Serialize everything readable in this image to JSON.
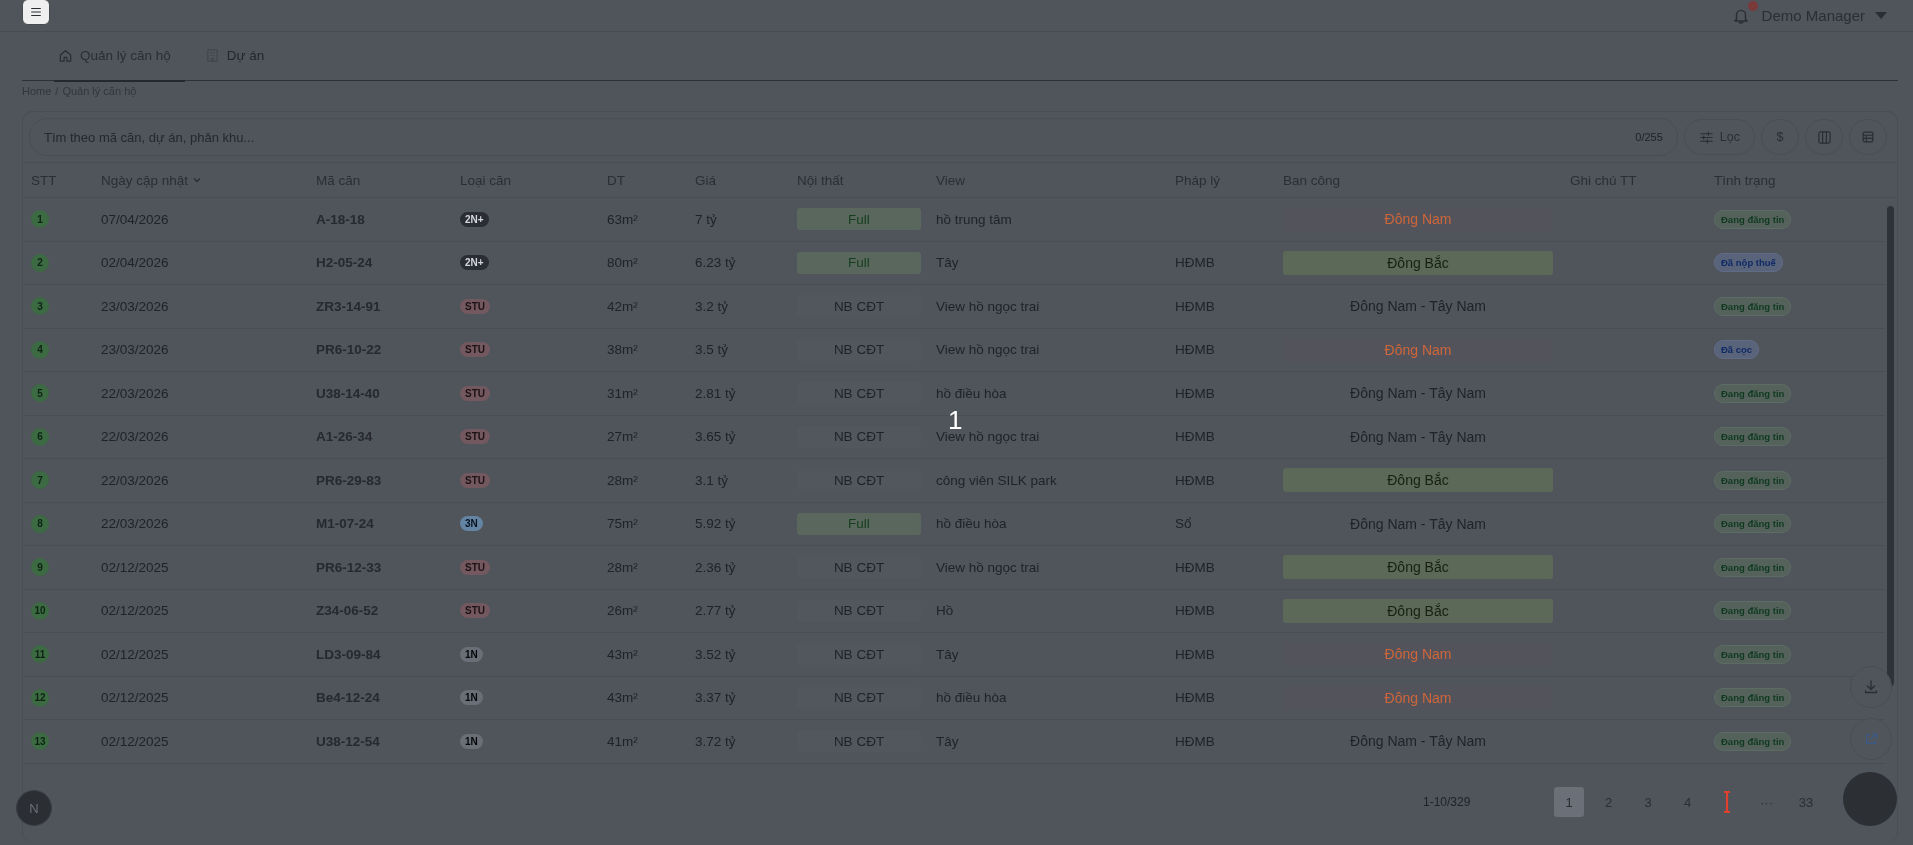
{
  "topbar": {
    "user": "Demo Manager"
  },
  "tabs": [
    {
      "label": "Quản lý căn hộ",
      "kind": "home",
      "selected": true
    },
    {
      "label": "Dự án",
      "kind": "building",
      "selected": false
    }
  ],
  "breadcrumb": {
    "items": [
      "Home",
      "Quản lý căn hộ"
    ],
    "separator": "/"
  },
  "search": {
    "placeholder": "Tìm theo mã căn, dự án, phân khu...",
    "counter": "0/255"
  },
  "toolbar": [
    {
      "kind": "filter",
      "label": "Lọc"
    },
    {
      "kind": "currency",
      "label": "$"
    },
    {
      "kind": "columns"
    },
    {
      "kind": "table"
    }
  ],
  "table": {
    "columns": [
      {
        "label": "STT",
        "sorted": false
      },
      {
        "label": "Ngày cập nhật",
        "sorted": true
      },
      {
        "label": "Mã căn",
        "sorted": false
      },
      {
        "label": "Loại căn",
        "sorted": false
      },
      {
        "label": "DT",
        "sorted": false
      },
      {
        "label": "Giá",
        "sorted": false
      },
      {
        "label": "Nội thất",
        "sorted": false
      },
      {
        "label": "View",
        "sorted": false
      },
      {
        "label": "Pháp lý",
        "sorted": false
      },
      {
        "label": "Ban công",
        "sorted": false
      },
      {
        "label": "Ghi chú TT",
        "sorted": false
      },
      {
        "label": "Tình trạng",
        "sorted": false
      }
    ],
    "rows": [
      {
        "stt": "1",
        "date": "07/04/2026",
        "code": "A-18-18",
        "type": {
          "label": "2N+",
          "kind": "twobedplus"
        },
        "area": "63m²",
        "price": "7 tỷ",
        "furniture": {
          "label": "Full",
          "kind": "full"
        },
        "view": "hồ trung tâm",
        "balcony": {
          "label": "Đông Nam",
          "kind": "southeast"
        },
        "status": {
          "label": "Đang đăng tin",
          "kind": "posted"
        }
      },
      {
        "stt": "2",
        "date": "02/04/2026",
        "code": "H2-05-24",
        "type": {
          "label": "2N+",
          "kind": "twobedplus"
        },
        "area": "80m²",
        "price": "6.23 tỷ",
        "furniture": {
          "label": "Full",
          "kind": "full"
        },
        "view": "Tây",
        "legal": "HĐMB",
        "balcony": {
          "label": "Đông Bắc",
          "kind": "northeast"
        },
        "status": {
          "label": "Đã nộp thuế",
          "kind": "tax_paid"
        }
      },
      {
        "stt": "3",
        "date": "23/03/2026",
        "code": "ZR3-14-91",
        "type": {
          "label": "STU",
          "kind": "studio"
        },
        "area": "42m²",
        "price": "3.2 tỷ",
        "furniture": {
          "label": "NB CĐT",
          "kind": "basic"
        },
        "view": "View hồ ngọc trai",
        "legal": "HĐMB",
        "balcony": {
          "label": "Đông Nam - Tây Nam",
          "kind": "mixed"
        },
        "status": {
          "label": "Đang đăng tin",
          "kind": "posted"
        }
      },
      {
        "stt": "4",
        "date": "23/03/2026",
        "code": "PR6-10-22",
        "type": {
          "label": "STU",
          "kind": "studio"
        },
        "area": "38m²",
        "price": "3.5 tỷ",
        "furniture": {
          "label": "NB CĐT",
          "kind": "basic"
        },
        "view": "View hồ ngọc trai",
        "legal": "HĐMB",
        "balcony": {
          "label": "Đông Nam",
          "kind": "southeast"
        },
        "status": {
          "label": "Đã cọc",
          "kind": "deposit"
        }
      },
      {
        "stt": "5",
        "date": "22/03/2026",
        "code": "U38-14-40",
        "type": {
          "label": "STU",
          "kind": "studio"
        },
        "area": "31m²",
        "price": "2.81 tỷ",
        "furniture": {
          "label": "NB CĐT",
          "kind": "basic"
        },
        "view": "hồ điều hòa",
        "legal": "HĐMB",
        "balcony": {
          "label": "Đông Nam - Tây Nam",
          "kind": "mixed"
        },
        "status": {
          "label": "Đang đăng tin",
          "kind": "posted"
        }
      },
      {
        "stt": "6",
        "date": "22/03/2026",
        "code": "A1-26-34",
        "type": {
          "label": "STU",
          "kind": "studio"
        },
        "area": "27m²",
        "price": "3.65 tỷ",
        "furniture": {
          "label": "NB CĐT",
          "kind": "basic"
        },
        "view": "View hồ ngọc trai",
        "legal": "HĐMB",
        "balcony": {
          "label": "Đông Nam - Tây Nam",
          "kind": "mixed"
        },
        "status": {
          "label": "Đang đăng tin",
          "kind": "posted"
        }
      },
      {
        "stt": "7",
        "date": "22/03/2026",
        "code": "PR6-29-83",
        "type": {
          "label": "STU",
          "kind": "studio"
        },
        "area": "28m²",
        "price": "3.1 tỷ",
        "furniture": {
          "label": "NB CĐT",
          "kind": "basic"
        },
        "view": "công viên SILK park",
        "legal": "HĐMB",
        "balcony": {
          "label": "Đông Bắc",
          "kind": "northeast"
        },
        "status": {
          "label": "Đang đăng tin",
          "kind": "posted"
        }
      },
      {
        "stt": "8",
        "date": "22/03/2026",
        "code": "M1-07-24",
        "type": {
          "label": "3N",
          "kind": "threebed"
        },
        "area": "75m²",
        "price": "5.92 tỷ",
        "furniture": {
          "label": "Full",
          "kind": "full"
        },
        "view": "hồ điều hòa",
        "legal": "Sổ",
        "balcony": {
          "label": "Đông Nam - Tây Nam",
          "kind": "mixed"
        },
        "status": {
          "label": "Đang đăng tin",
          "kind": "posted"
        }
      },
      {
        "stt": "9",
        "date": "02/12/2025",
        "code": "PR6-12-33",
        "type": {
          "label": "STU",
          "kind": "studio"
        },
        "area": "28m²",
        "price": "2.36 tỷ",
        "furniture": {
          "label": "NB CĐT",
          "kind": "basic"
        },
        "view": "View hồ ngọc trai",
        "legal": "HĐMB",
        "balcony": {
          "label": "Đông Bắc",
          "kind": "northeast"
        },
        "status": {
          "label": "Đang đăng tin",
          "kind": "posted"
        }
      },
      {
        "stt": "10",
        "date": "02/12/2025",
        "code": "Z34-06-52",
        "type": {
          "label": "STU",
          "kind": "studio"
        },
        "area": "26m²",
        "price": "2.77 tỷ",
        "furniture": {
          "label": "NB CĐT",
          "kind": "basic"
        },
        "view": "Hồ",
        "legal": "HĐMB",
        "balcony": {
          "label": "Đông Bắc",
          "kind": "northeast"
        },
        "status": {
          "label": "Đang đăng tin",
          "kind": "posted"
        }
      },
      {
        "stt": "11",
        "date": "02/12/2025",
        "code": "LD3-09-84",
        "type": {
          "label": "1N",
          "kind": "onebed"
        },
        "area": "43m²",
        "price": "3.52 tỷ",
        "furniture": {
          "label": "NB CĐT",
          "kind": "basic"
        },
        "view": "Tây",
        "legal": "HĐMB",
        "balcony": {
          "label": "Đông Nam",
          "kind": "southeast"
        },
        "status": {
          "label": "Đang đăng tin",
          "kind": "posted"
        }
      },
      {
        "stt": "12",
        "date": "02/12/2025",
        "code": "Be4-12-24",
        "type": {
          "label": "1N",
          "kind": "onebed"
        },
        "area": "43m²",
        "price": "3.37 tỷ",
        "furniture": {
          "label": "NB CĐT",
          "kind": "basic"
        },
        "view": "hồ điều hòa",
        "legal": "HĐMB",
        "balcony": {
          "label": "Đông Nam",
          "kind": "southeast"
        },
        "status": {
          "label": "Đang đăng tin",
          "kind": "posted"
        }
      },
      {
        "stt": "13",
        "date": "02/12/2025",
        "code": "U38-12-54",
        "type": {
          "label": "1N",
          "kind": "onebed"
        },
        "area": "41m²",
        "price": "3.72 tỷ",
        "furniture": {
          "label": "NB CĐT",
          "kind": "basic"
        },
        "view": "Tây",
        "legal": "HĐMB",
        "balcony": {
          "label": "Đông Nam - Tây Nam",
          "kind": "mixed"
        },
        "status": {
          "label": "Đang đăng tin",
          "kind": "posted"
        }
      }
    ]
  },
  "pagination": {
    "range": "1-10/329",
    "pages": [
      {
        "kind": "page",
        "label": "1",
        "selected": true
      },
      {
        "kind": "page",
        "label": "2",
        "selected": false
      },
      {
        "kind": "page",
        "label": "3",
        "selected": false
      },
      {
        "kind": "page",
        "label": "4",
        "selected": false
      },
      {
        "kind": "cursor"
      },
      {
        "kind": "ellipsis",
        "label": "···"
      },
      {
        "kind": "page",
        "label": "33",
        "selected": false
      }
    ]
  },
  "dev_badge": {
    "label": "N"
  },
  "step_number": "1"
}
